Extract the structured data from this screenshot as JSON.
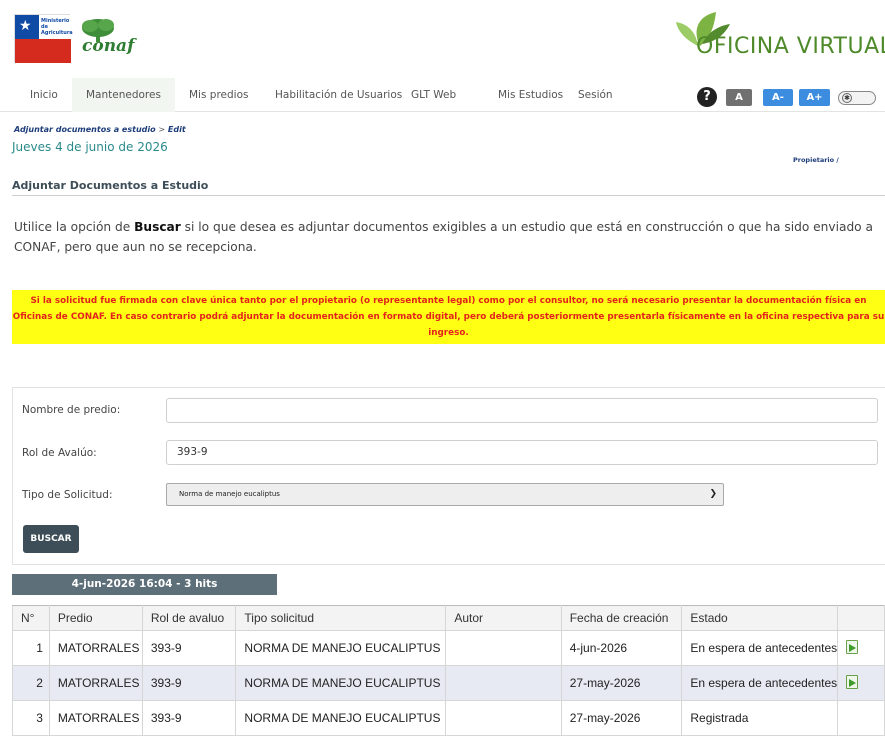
{
  "header": {
    "gob_logo_text": "Ministerio de Agricultura",
    "conaf_logo_text": "conaf",
    "oficina_virtual": "OFICINA VIRTUAL"
  },
  "nav": {
    "items": [
      {
        "label": "Inicio"
      },
      {
        "label": "Mantenedores"
      },
      {
        "label": "Mis predios"
      },
      {
        "label": "Habilitación de Usuarios"
      },
      {
        "label": "GLT Web"
      },
      {
        "label": "Mis Estudios"
      },
      {
        "label": "Sesión"
      }
    ],
    "active_index": 1,
    "tools": {
      "help": "?",
      "font_normal": "A",
      "font_decrease": "A-",
      "font_increase": "A+",
      "toggle_icon": "contrast-toggle-icon",
      "font_normal_color": "#707070",
      "font_size_color": "#3c8de0"
    }
  },
  "breadcrumb": {
    "parent": "Adjuntar documentos a estudio",
    "separator": ">",
    "current": "Edit"
  },
  "date": "Jueves 4 de junio de 2026",
  "owner_label": "Propietario / ",
  "page": {
    "title": "Adjuntar Documentos a Estudio",
    "intro_before": "Utilice la opción de ",
    "intro_bold": "Buscar",
    "intro_after": " si lo que desea es adjuntar documentos exigibles a un estudio que está en construcción o que ha sido enviado a CONAF, pero que aun no se recepciona.",
    "warning": "Si la solicitud fue firmada con clave única tanto por el propietario (o representante legal) como por el consultor, no será necesario presentar la documentación física en Oficinas de CONAF. En caso contrario podrá adjuntar la documentación en formato digital, pero deberá posteriormente presentarla físicamente en la oficina respectiva para su ingreso."
  },
  "search": {
    "predio_label": "Nombre de predio:",
    "predio_value": "",
    "rol_label": "Rol de Avalúo:",
    "rol_value": "393-9",
    "tipo_label": "Tipo de Solicitud:",
    "tipo_value": "Norma de manejo eucaliptus",
    "button": "BUSCAR"
  },
  "results": {
    "hits": "4-jun-2026 16:04 - 3 hits",
    "columns": [
      "N°",
      "Predio",
      "Rol de avaluo",
      "Tipo solicitud",
      "Autor",
      "Fecha de creación",
      "Estado",
      ""
    ],
    "rows": [
      {
        "n": "1",
        "predio": "MATORRALES",
        "rol": "393-9",
        "tipo": "NORMA DE MANEJO EUCALIPTUS",
        "autor": "",
        "fecha": "4-jun-2026",
        "estado": "En espera de antecedentes",
        "icon": "attach-document-icon"
      },
      {
        "n": "2",
        "predio": "MATORRALES",
        "rol": "393-9",
        "tipo": "NORMA DE MANEJO EUCALIPTUS",
        "autor": "",
        "fecha": "27-may-2026",
        "estado": "En espera de antecedentes",
        "icon": "attach-document-icon"
      },
      {
        "n": "3",
        "predio": "MATORRALES",
        "rol": "393-9",
        "tipo": "NORMA DE MANEJO EUCALIPTUS",
        "autor": "",
        "fecha": "27-may-2026",
        "estado": "Registrada",
        "icon": ""
      }
    ]
  }
}
